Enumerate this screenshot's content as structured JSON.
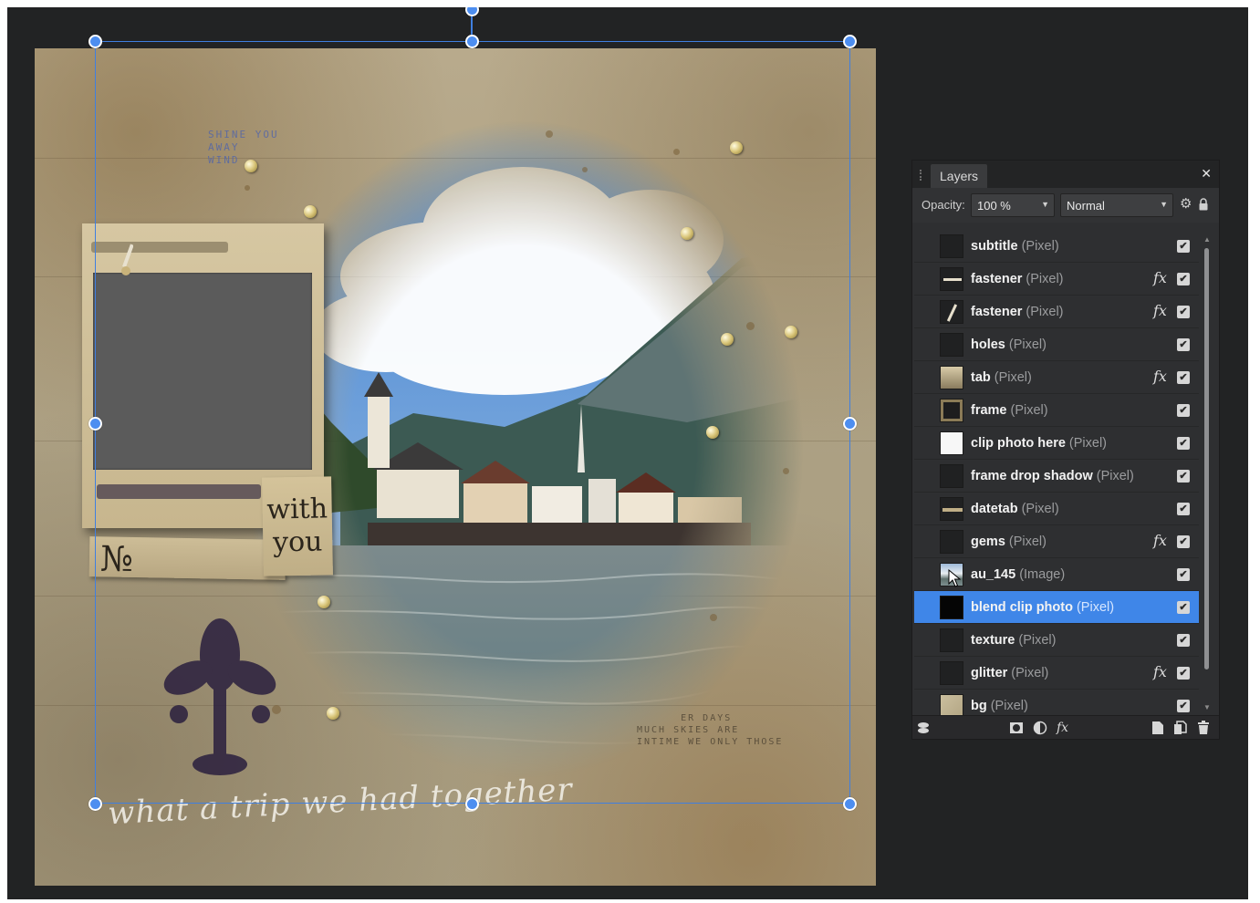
{
  "canvas": {
    "tag_word_1": "with",
    "tag_word_2": "you",
    "no_label": "№",
    "title_script": "what a trip we had together",
    "stamp_text_top": "SHINE YOU\nAWAY\nWIND",
    "stamp_text_bottom": "      ER DAYS\nMUCH SKIES ARE\nINTIME WE ONLY THOSE"
  },
  "layers_panel": {
    "tab_label": "Layers",
    "close_icon": "close-icon",
    "opacity_label": "Opacity:",
    "opacity_value": "100 %",
    "blend_mode": "Normal",
    "layers": [
      {
        "name": "subtitle",
        "type": "(Pixel)",
        "fx": false,
        "visible": true,
        "selected": false,
        "thumb": "dark"
      },
      {
        "name": "fastener",
        "type": "(Pixel)",
        "fx": true,
        "visible": true,
        "selected": false,
        "thumb": "fastener-h"
      },
      {
        "name": "fastener",
        "type": "(Pixel)",
        "fx": true,
        "visible": true,
        "selected": false,
        "thumb": "fastener-v"
      },
      {
        "name": "holes",
        "type": "(Pixel)",
        "fx": false,
        "visible": true,
        "selected": false,
        "thumb": "dark"
      },
      {
        "name": "tab",
        "type": "(Pixel)",
        "fx": true,
        "visible": true,
        "selected": false,
        "thumb": "tab"
      },
      {
        "name": "frame",
        "type": "(Pixel)",
        "fx": false,
        "visible": true,
        "selected": false,
        "thumb": "frame"
      },
      {
        "name": "clip photo here",
        "type": "(Pixel)",
        "fx": false,
        "visible": true,
        "selected": false,
        "thumb": "white"
      },
      {
        "name": "frame drop shadow",
        "type": "(Pixel)",
        "fx": false,
        "visible": true,
        "selected": false,
        "thumb": "dark"
      },
      {
        "name": "datetab",
        "type": "(Pixel)",
        "fx": false,
        "visible": true,
        "selected": false,
        "thumb": "datetab"
      },
      {
        "name": "gems",
        "type": "(Pixel)",
        "fx": true,
        "visible": true,
        "selected": false,
        "thumb": "dark"
      },
      {
        "name": "au_145",
        "type": "(Image)",
        "fx": false,
        "visible": true,
        "selected": false,
        "thumb": "photo"
      },
      {
        "name": "blend clip photo",
        "type": "(Pixel)",
        "fx": false,
        "visible": true,
        "selected": true,
        "thumb": "black"
      },
      {
        "name": "texture",
        "type": "(Pixel)",
        "fx": false,
        "visible": true,
        "selected": false,
        "thumb": "dark"
      },
      {
        "name": "glitter",
        "type": "(Pixel)",
        "fx": true,
        "visible": true,
        "selected": false,
        "thumb": "dark"
      },
      {
        "name": "bg",
        "type": "(Pixel)",
        "fx": false,
        "visible": true,
        "selected": false,
        "thumb": "bg"
      }
    ],
    "fx_symbol": "fx",
    "check_symbol": "✔",
    "footer_icons": [
      "layer-options-icon",
      "mask-icon",
      "adjustment-icon",
      "fx-icon",
      "new-layer-icon",
      "duplicate-layer-icon",
      "trash-icon"
    ]
  },
  "colors": {
    "workspace": "#222324",
    "selection": "#3f7fe0",
    "panel": "#2e2f31",
    "selected_row": "#3f86e8"
  }
}
